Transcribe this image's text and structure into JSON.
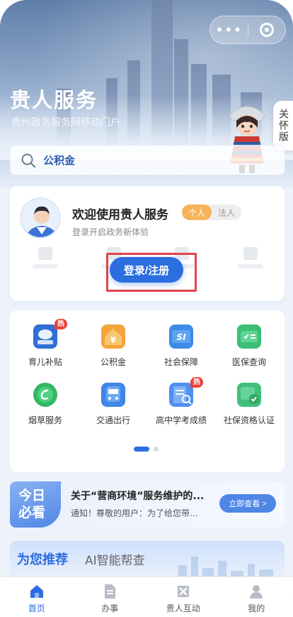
{
  "header": {
    "title": "贵人服务",
    "subtitle": "贵州政务服务网移动门户",
    "care_mode": "关怀版"
  },
  "search": {
    "text": "公积金"
  },
  "welcome": {
    "title": "欢迎使用贵人服务",
    "subtitle": "登录开启政务新体验",
    "toggle": [
      "个人",
      "法人"
    ],
    "toggle_selected": "个人",
    "login_label": "登录/注册"
  },
  "services": {
    "items": [
      {
        "label": "育儿补贴",
        "icon": "childcare-subsidy-icon",
        "hot": "热"
      },
      {
        "label": "公积金",
        "icon": "housing-fund-icon"
      },
      {
        "label": "社会保障",
        "icon": "social-security-icon"
      },
      {
        "label": "医保查询",
        "icon": "medical-insurance-icon"
      },
      {
        "label": "烟草服务",
        "icon": "tobacco-service-icon"
      },
      {
        "label": "交通出行",
        "icon": "bus-icon"
      },
      {
        "label": "高中学考成绩",
        "icon": "exam-score-icon",
        "hot": "热"
      },
      {
        "label": "社保资格认证",
        "icon": "qualification-cert-icon"
      }
    ],
    "page": 1,
    "pages": 2
  },
  "today": {
    "badge_line1": "今日",
    "badge_line2": "必看",
    "title": "关于“营商环境”服务维护的...",
    "subtitle": "通知！尊敬的用户：为了给您带...",
    "button": "立即查看 >"
  },
  "recommend": {
    "active_tab": "为您推荐",
    "tab": "AI智能帮查"
  },
  "tabbar": {
    "items": [
      "首页",
      "办事",
      "贵人互动",
      "我的"
    ],
    "active": "首页"
  },
  "colors": {
    "primary": "#2c6de0",
    "hot": "#e8413a",
    "toggle_active": "#f6b45a",
    "highlight_frame": "#e0454a"
  }
}
